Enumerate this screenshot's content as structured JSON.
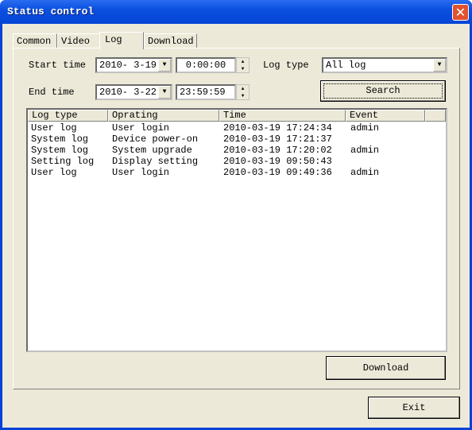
{
  "window": {
    "title": "Status control",
    "close_icon": "close-icon"
  },
  "tabs": [
    {
      "label": "Common"
    },
    {
      "label": "Video"
    },
    {
      "label": "Log",
      "selected": true
    },
    {
      "label": "Download"
    }
  ],
  "filters": {
    "start_time_label": "Start time",
    "start_date": "2010- 3-19",
    "start_time": "0:00:00",
    "end_time_label": "End time",
    "end_date": "2010- 3-22",
    "end_time": "23:59:59",
    "log_type_label": "Log type",
    "log_type": "All log",
    "search_label": "Search"
  },
  "table": {
    "columns": [
      "Log type",
      "Oprating",
      "Time",
      "Event"
    ],
    "rows": [
      [
        "User log",
        "User login",
        "2010-03-19 17:24:34",
        "admin"
      ],
      [
        "System log",
        "Device power-on",
        "2010-03-19 17:21:37",
        ""
      ],
      [
        "System log",
        "System upgrade",
        "2010-03-19 17:20:02",
        "admin"
      ],
      [
        "Setting log",
        "Display setting",
        "2010-03-19 09:50:43",
        ""
      ],
      [
        "User log",
        "User login",
        "2010-03-19 09:49:36",
        "admin"
      ]
    ]
  },
  "download_label": "Download",
  "exit_label": "Exit"
}
